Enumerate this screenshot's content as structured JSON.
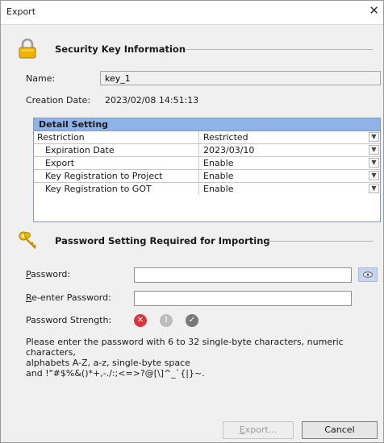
{
  "window": {
    "title": "Export",
    "close_glyph": "✕"
  },
  "security": {
    "header": "Security Key Information",
    "name_label": "Name:",
    "name_value": "key_1",
    "creation_label": "Creation Date:",
    "creation_value": "2023/02/08 14:51:13"
  },
  "detail": {
    "header": "Detail Setting",
    "rows": [
      {
        "label": "Restriction",
        "value": "Restricted"
      },
      {
        "label": "Expiration Date",
        "value": "2023/03/10"
      },
      {
        "label": "Export",
        "value": "Enable"
      },
      {
        "label": "Key Registration to Project",
        "value": "Enable"
      },
      {
        "label": "Key Registration to GOT",
        "value": "Enable"
      }
    ]
  },
  "password": {
    "header": "Password Setting Required for Importing",
    "password_label_first": "P",
    "password_label_rest": "assword:",
    "reenter_label_first": "R",
    "reenter_label_rest": "e-enter Password:",
    "strength_label": "Password Strength:",
    "strength_icons": [
      "error-icon",
      "warning-icon",
      "check-icon"
    ]
  },
  "info": {
    "line1": "Please enter the password with 6 to 32 single-byte characters, numeric characters,",
    "line2": "alphabets A-Z, a-z, single-byte space",
    "line3": "and !\"#$%&()*+,-./:;<=>?@[\\]^_`{|}~."
  },
  "buttons": {
    "export_first": "E",
    "export_rest": "xport...",
    "cancel": "Cancel"
  },
  "colors": {
    "detail_header": "#8fb3e6",
    "error": "#d9363e",
    "warning": "#bcbcbc",
    "check": "#7a7a7a",
    "eye_button": "#c7d5ec"
  }
}
